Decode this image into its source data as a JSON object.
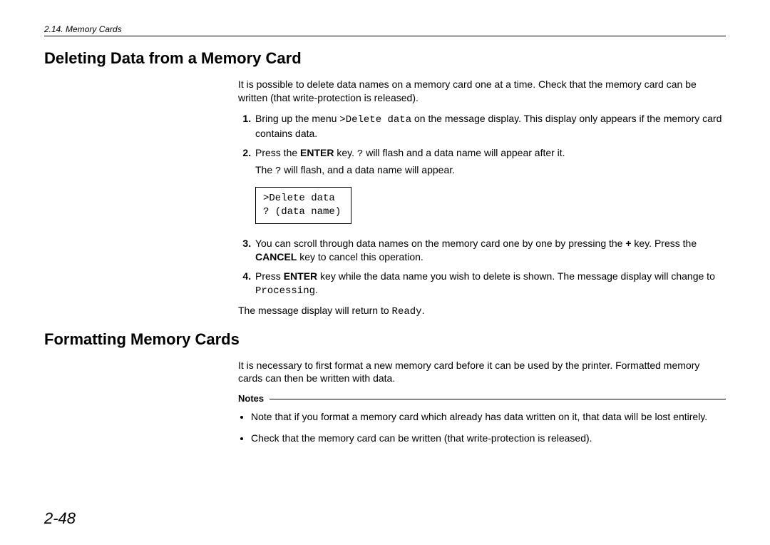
{
  "header": {
    "section_label": "2.14.  Memory Cards"
  },
  "section1": {
    "title": "Deleting Data from a Memory Card",
    "intro": "It is possible to delete data names on a memory card one at a time.  Check that the memory card can be written (that write-protection is released).",
    "step1_a": "Bring up the menu ",
    "step1_code": ">Delete data",
    "step1_b": " on the message display.  This display only appears if the memory card contains data.",
    "step2_a": "Press the ",
    "step2_key": "ENTER",
    "step2_b": " key. ",
    "step2_q": "?",
    "step2_c": " will flash and a data name will appear after it.",
    "step2_note_a": "The ",
    "step2_note_q": "?",
    "step2_note_b": " will flash, and a data name will appear.",
    "display_line1": ">Delete data",
    "display_line2": "? (data name)",
    "step3_a": "You can scroll through data names on the memory card one by one by pressing the ",
    "step3_plus": "+",
    "step3_b": " key. Press the ",
    "step3_cancel": "CANCEL",
    "step3_c": " key to cancel this operation.",
    "step4_a": "Press ",
    "step4_enter": "ENTER",
    "step4_b": " key while the data name you wish to delete is shown.  The message display will change to ",
    "step4_proc": "Processing",
    "step4_c": ".",
    "after_a": "The message display will return to ",
    "after_ready": "Ready",
    "after_b": "."
  },
  "section2": {
    "title": "Formatting Memory Cards",
    "intro": "It is necessary to first format a new memory card before it can be used by the printer.  Formatted memory cards can then be written with data.",
    "notes_label": "Notes",
    "note1": "Note that if you format a memory card which already has data written on it, that data will be lost entirely.",
    "note2": "Check that the memory card can be written (that write-protection is released)."
  },
  "page_number": "2-48"
}
